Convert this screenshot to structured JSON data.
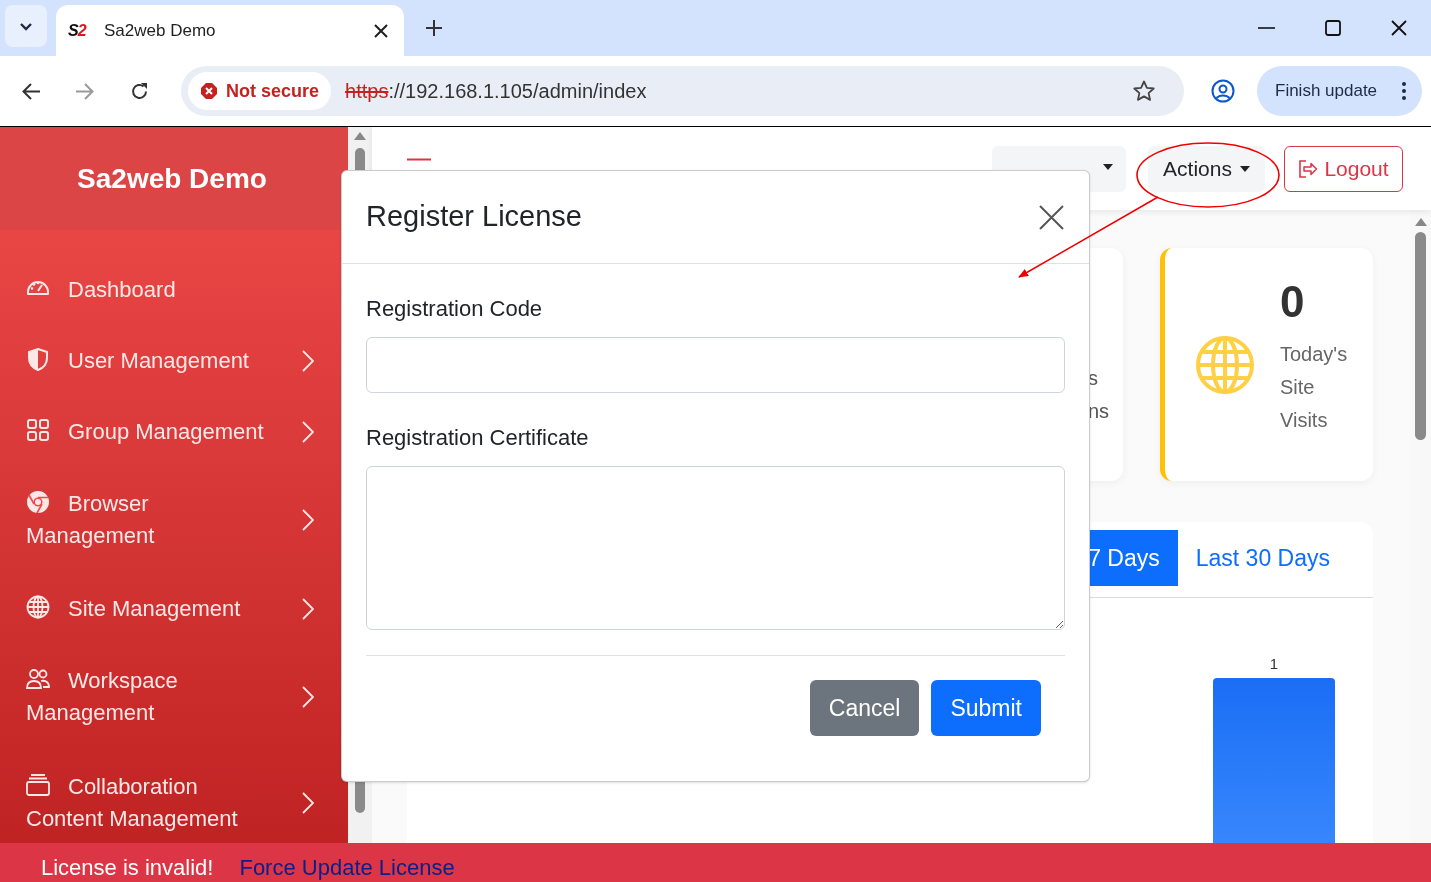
{
  "browser": {
    "favicon": [
      "S",
      "2"
    ],
    "tab_title": "Sa2web Demo",
    "security_chip": "Not secure",
    "url_scheme": "https",
    "url_rest": "://192.168.1.105/admin/index",
    "update_button": "Finish update"
  },
  "sidebar": {
    "brand": "Sa2web Demo",
    "items": [
      {
        "label": "Dashboard",
        "kind": "single",
        "expandable": false
      },
      {
        "label": "User Management",
        "kind": "single",
        "expandable": true
      },
      {
        "label": "Group Management",
        "kind": "single",
        "expandable": true
      },
      {
        "label": "Browser Management",
        "kind": "wrapped",
        "expandable": true
      },
      {
        "label": "Site Management",
        "kind": "single",
        "expandable": true
      },
      {
        "label": "Workspace Management",
        "kind": "wrapped",
        "expandable": true
      },
      {
        "label": "Collaboration Content Management",
        "kind": "wrapped",
        "expandable": true
      }
    ]
  },
  "header": {
    "actions": "Actions",
    "logout": "Logout"
  },
  "stats": {
    "partial_card_lines": [
      "s",
      "ns"
    ],
    "visits_card": {
      "value": "0",
      "label": "Today's Site Visits"
    }
  },
  "chart_panel": {
    "tabs": [
      {
        "label": "7 Days",
        "selected": true
      },
      {
        "label": "Last 30 Days",
        "selected": false
      }
    ],
    "bar_label": "1"
  },
  "modal": {
    "title": "Register License",
    "fields": [
      {
        "label": "Registration Code",
        "kind": "input"
      },
      {
        "label": "Registration Certificate",
        "kind": "textarea"
      }
    ],
    "buttons": [
      {
        "label": "Cancel",
        "kind": "secondary"
      },
      {
        "label": "Submit",
        "kind": "primary"
      }
    ]
  },
  "license_banner": {
    "message": "License is invalid!",
    "link": "Force Update License"
  }
}
